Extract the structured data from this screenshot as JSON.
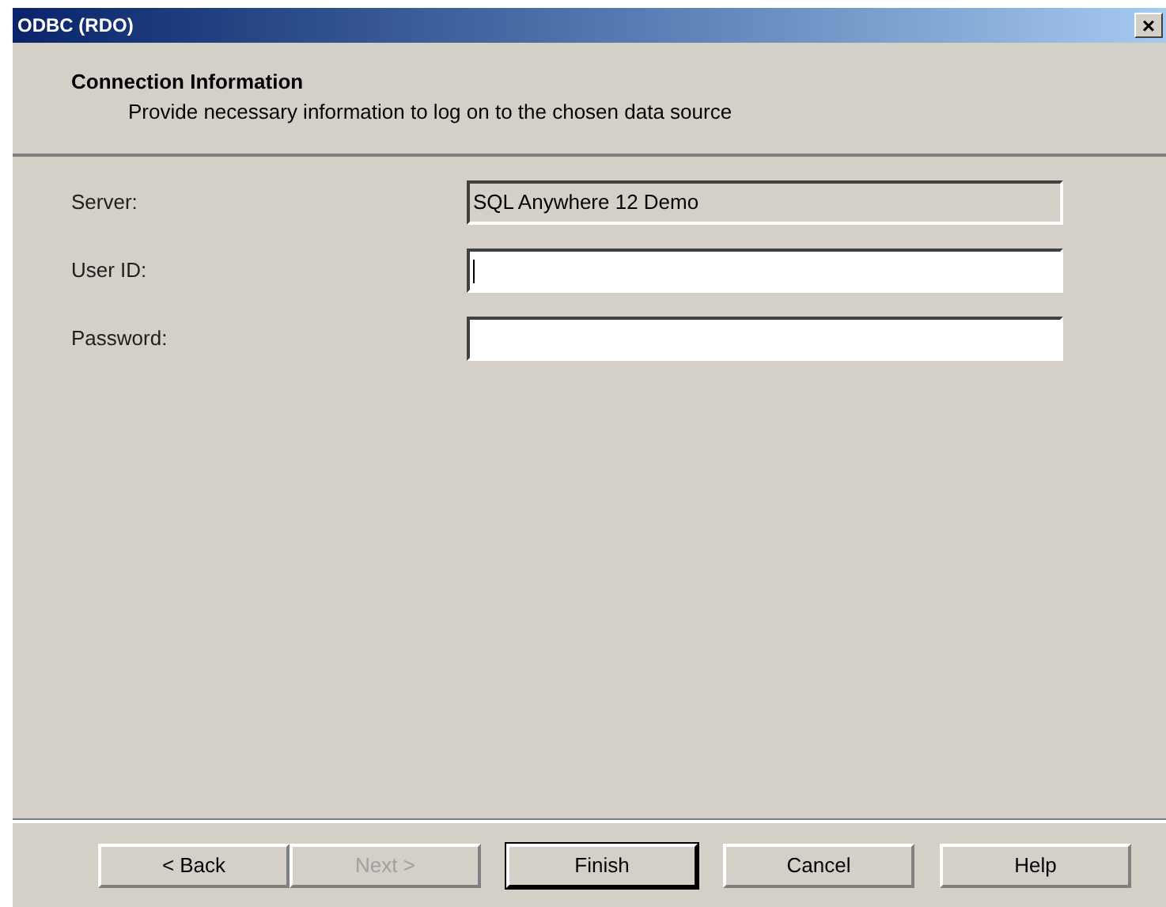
{
  "window": {
    "title": "ODBC (RDO)",
    "close": "×"
  },
  "header": {
    "title": "Connection Information",
    "subtitle": "Provide necessary information to log on to the chosen data source"
  },
  "fields": [
    {
      "label": "Server:",
      "value": "SQL Anywhere 12 Demo",
      "readonly": true,
      "focused": false
    },
    {
      "label": "User ID:",
      "readonly": false,
      "focused": true
    },
    {
      "label": "Password:",
      "readonly": false,
      "focused": false
    }
  ],
  "buttons": [
    {
      "label": "< Back",
      "disabled": false,
      "default": false
    },
    {
      "label": "Next >",
      "disabled": true,
      "default": false
    },
    {
      "label": "Finish",
      "disabled": false,
      "default": true
    },
    {
      "label": "Cancel",
      "disabled": false,
      "default": false
    },
    {
      "label": "Help",
      "disabled": false,
      "default": false
    }
  ]
}
